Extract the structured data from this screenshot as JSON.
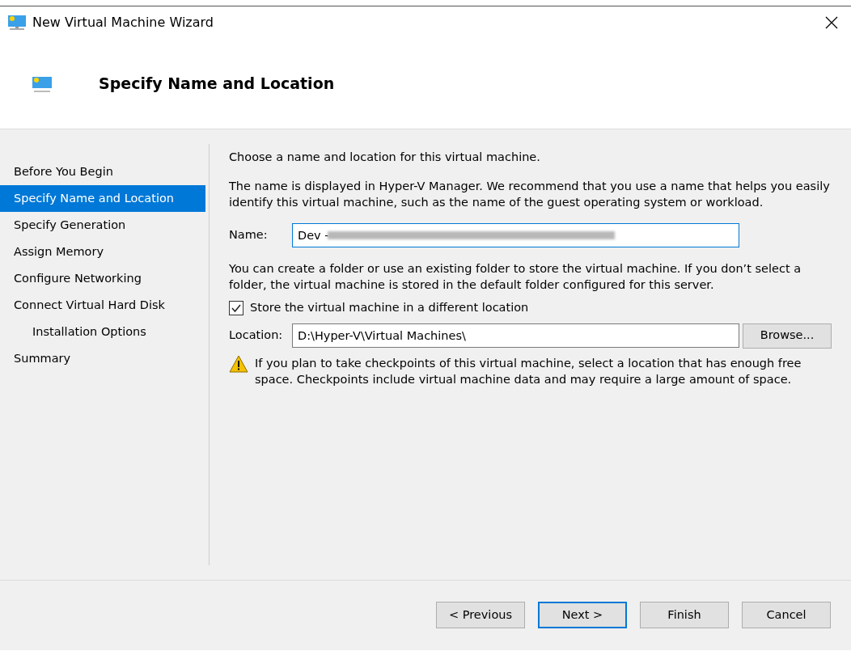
{
  "window": {
    "title": "New Virtual Machine Wizard"
  },
  "header": {
    "title": "Specify Name and Location"
  },
  "steps": [
    {
      "label": "Before You Begin",
      "selected": false
    },
    {
      "label": "Specify Name and Location",
      "selected": true
    },
    {
      "label": "Specify Generation",
      "selected": false
    },
    {
      "label": "Assign Memory",
      "selected": false
    },
    {
      "label": "Configure Networking",
      "selected": false
    },
    {
      "label": "Connect Virtual Hard Disk",
      "selected": false,
      "children": [
        {
          "label": "Installation Options",
          "selected": false
        }
      ]
    },
    {
      "label": "Summary",
      "selected": false
    }
  ],
  "content": {
    "intro": "Choose a name and location for this virtual machine.",
    "name_help": "The name is displayed in Hyper-V Manager. We recommend that you use a name that helps you easily identify this virtual machine, such as the name of the guest operating system or workload.",
    "name_label": "Name:",
    "name_value": "Dev - ",
    "folder_help": "You can create a folder or use an existing folder to store the virtual machine. If you don’t select a folder, the virtual machine is stored in the default folder configured for this server.",
    "store_checkbox": {
      "label": "Store the virtual machine in a different location",
      "checked": true
    },
    "location_label": "Location:",
    "location_value": "D:\\Hyper-V\\Virtual Machines\\",
    "browse": "Browse...",
    "warning": "If you plan to take checkpoints of this virtual machine, select a location that has enough free space. Checkpoints include virtual machine data and may require a large amount of space."
  },
  "buttons": [
    {
      "label": "< Previous",
      "focused": false
    },
    {
      "label": "Next >",
      "focused": true
    },
    {
      "label": "Finish",
      "focused": false
    },
    {
      "label": "Cancel",
      "focused": false
    }
  ]
}
